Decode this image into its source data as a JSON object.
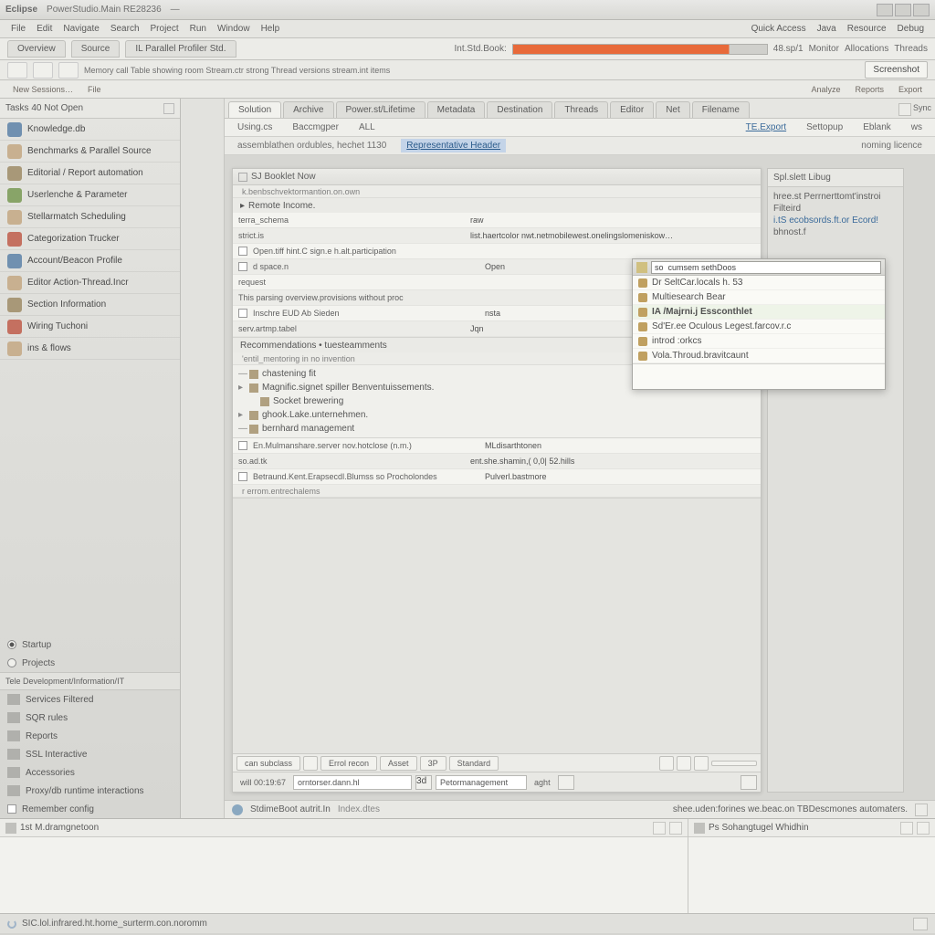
{
  "title": {
    "app": "Eclipse",
    "doc": "PowerStudio.Main  RE28236",
    "tab2": "—"
  },
  "menu": {
    "items": [
      "File",
      "Edit",
      "Navigate",
      "Search",
      "Project",
      "Run",
      "Window",
      "Help"
    ],
    "right": [
      "Quick Access",
      "            ",
      "Java",
      "Resource",
      "Debug"
    ]
  },
  "persp": {
    "tabs": [
      "Overview",
      "Source",
      "IL Parallel Profiler Std."
    ],
    "left_label": "Int.Std.Book:",
    "progress_pct": 85,
    "right_label": "48.sp/1",
    "extras": [
      "Monitor",
      "Allocations",
      "Threads"
    ]
  },
  "tool1": {
    "crumb": "Memory call Table   showing room   Stream.ctr   strong    Thread   versions   stream.int   items",
    "rbtn": "Screenshot"
  },
  "tool2": {
    "items": [
      "New Sessions…",
      "File",
      "",
      "",
      "",
      "Analyze",
      "Reports",
      "Export"
    ]
  },
  "leftnav": {
    "head": "Tasks   40 Not Open",
    "items": [
      {
        "label": "Knowledge.db",
        "cls": "blue"
      },
      {
        "label": "Benchmarks & Parallel Source",
        "cls": ""
      },
      {
        "label": "Editorial / Report automation",
        "cls": "alt"
      },
      {
        "label": "Userlenche & Parameter",
        "cls": "green"
      },
      {
        "label": "Stellarmatch Scheduling",
        "cls": ""
      },
      {
        "label": "Categorization Trucker",
        "cls": "red"
      },
      {
        "label": "Account/Beacon Profile",
        "cls": "blue"
      },
      {
        "label": "Editor Action-Thread.Incr",
        "cls": ""
      },
      {
        "label": "Section Information",
        "cls": "alt"
      },
      {
        "label": "Wiring Tuchoni",
        "cls": "red"
      },
      {
        "label": "ins & flows",
        "cls": ""
      }
    ],
    "radios": [
      {
        "label": "Startup",
        "on": true
      },
      {
        "label": "Projects",
        "on": false
      }
    ],
    "subhead": "Tele  Development/Information/IT",
    "subs": [
      "Services Filtered",
      "SQR rules",
      "Reports",
      "SSL Interactive",
      "Accessories",
      "Proxy/db runtime interactions"
    ],
    "cb": "Remember config"
  },
  "viewtabs": {
    "tabs": [
      "Solution",
      "Archive",
      "Power.st/Lifetime",
      "Metadata",
      "Destination",
      "",
      "Threads",
      "Editor",
      "Net",
      "Filename"
    ],
    "sync": "Sync"
  },
  "subtabs": {
    "items": [
      "Using.cs",
      "Baccmgper",
      "ALL",
      "",
      "TE.Export",
      "Settopup",
      "Eblank",
      "ws"
    ]
  },
  "panel": {
    "head": "SJ Booklet  Now",
    "sub": "k.benbschvektormantion.on.own",
    "sec1_title": "Remote Income.",
    "sec1_rows": [
      {
        "k": "terra_schema",
        "v": "raw"
      },
      {
        "k": "strict.is",
        "v": "list.haertcolor   nwt.netmobilewest.onelingslomeniskow…"
      },
      {
        "k": "Open.tiff    hint.C   sign.e   h.alt.participation",
        "v": ""
      },
      {
        "k": "d   space.n",
        "v": "Open"
      },
      {
        "k": "request",
        "v": ""
      },
      {
        "k": "This parsing  overview.provisions   without proc",
        "v": ""
      },
      {
        "k": "Inschre   EUD   Ab Sieden",
        "v": "nsta"
      },
      {
        "k": "serv.artmp.tabel",
        "v": "Jqn"
      }
    ],
    "sec2_title": "Recommendations  •  tuesteamments",
    "sec2_sub": "'entil_mentoring   in  no  invention",
    "tree": [
      {
        "t": "—",
        "l": "chastening  fit"
      },
      {
        "t": "▸",
        "l": "Magnific.signet  spiller  Benventuissements."
      },
      {
        "t": "  ",
        "l": "Socket brewering"
      },
      {
        "t": "▸",
        "l": "ghook.Lake.unternehmen."
      },
      {
        "t": "—",
        "l": "bernhard management"
      }
    ],
    "sec3_rows": [
      {
        "k": "En.Mulmanshare.server  nov.hotclose  (n.m.)",
        "v": "MLdisarthtonen"
      },
      {
        "k": "so.ad.tk",
        "v": "ent.she.shamin,(  0,0|   52.hills"
      },
      {
        "k": "Betraund.Kent.Erapsecdl.Blumss so Procholondes",
        "v": "Pulverl.bastmore"
      }
    ],
    "sec3_tail": "r   errom.entrechalems",
    "toolrow": {
      "btns": [
        "can subclass",
        "",
        "Errol recon",
        "Asset",
        "3P",
        "Standard"
      ],
      "right_btns": [
        "",
        "",
        ""
      ]
    },
    "inprow": {
      "label": "will 00:19:67",
      "value": "orntorser.dann.hl",
      "btns": [
        "3d",
        "Petormanagement",
        "aght",
        ""
      ]
    }
  },
  "status": {
    "left": "StdimeBoot autrit.In",
    "mid": "Index.dtes",
    "right": "shee.uden:forines  we.beac.on  TBDescmones automaters."
  },
  "rightcol": {
    "head": "Spl.slett  Libug",
    "body": [
      "hree.st   Perrnerttomt'instroi  Filteird",
      "i.tS  ecobsords.ft.or  Ecord!",
      "bhnost.f"
    ]
  },
  "popup": {
    "input": "so  cumsem sethDoos",
    "items": [
      {
        "l": "Dr   SeltCar.locals   h.  53"
      },
      {
        "l": "Multiesearch Bear"
      },
      {
        "l": "IA  /Majrni.j  Essconthlet",
        "hl": true
      },
      {
        "l": "Sd'Er.ee  Oculous  Legest.farcov.r.c"
      },
      {
        "l": "introd   :orkcs"
      },
      {
        "l": "Vola.Throud.bravitcaunt"
      }
    ]
  },
  "bottom": {
    "left_title": "1st  M.dramgnetoon",
    "right_title": "Ps  Sohangtugel  Whidhin"
  },
  "statusbar": {
    "text": "SIC.lol.infrared.ht.home_surterm.con.noromm"
  }
}
